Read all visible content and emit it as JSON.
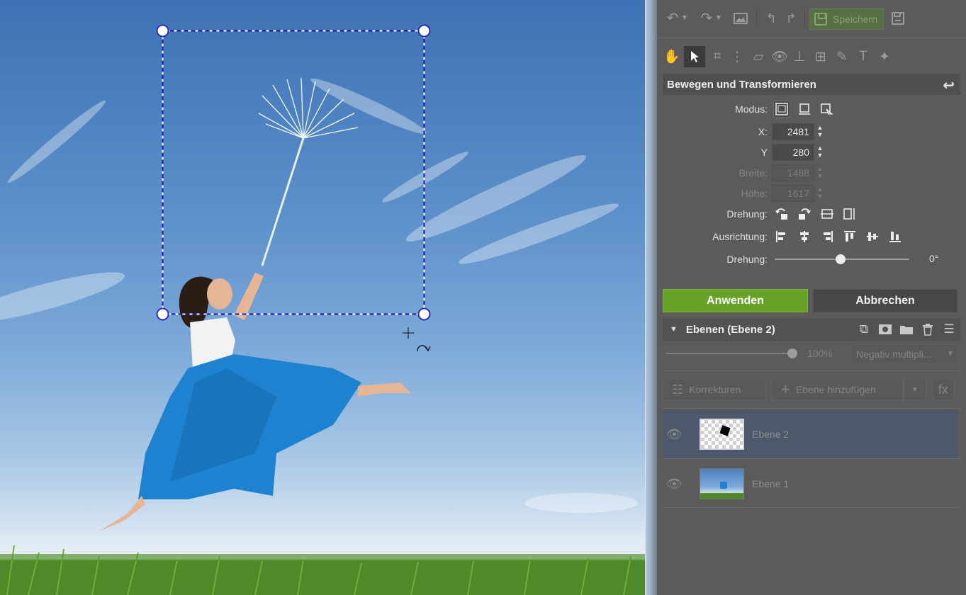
{
  "toolbar": {
    "save_label": "Speichern",
    "icons": [
      "undo-icon",
      "redo-icon",
      "image-icon",
      "rotate-left-icon",
      "rotate-right-icon",
      "save-icon",
      "save-as-icon"
    ]
  },
  "tools": [
    "hand-icon",
    "move-tool-icon",
    "crop-icon",
    "straighten-icon",
    "perspective-icon",
    "redeye-icon",
    "stamp-icon",
    "grid-icon",
    "brush-icon",
    "text-icon",
    "effects-icon"
  ],
  "transform": {
    "title": "Bewegen und Transformieren",
    "mode_label": "Modus:",
    "x_label": "X:",
    "x_value": "2481",
    "y_label": "Y",
    "y_value": "280",
    "width_label": "Breite:",
    "width_value": "1488",
    "height_label": "Höhe:",
    "height_value": "1617",
    "rotation_label": "Drehung:",
    "alignment_label": "Ausrichtung:",
    "rotation_slider_label": "Drehung:",
    "rotation_degrees": "0°"
  },
  "actions": {
    "apply": "Anwenden",
    "cancel": "Abbrechen"
  },
  "layers": {
    "title": "Ebenen (Ebene 2)",
    "opacity": "100%",
    "blend_mode": "Negativ multipli...",
    "corrections": "Korrekturen",
    "add_layer": "Ebene hinzufügen",
    "fx": "fx",
    "items": [
      {
        "name": "Ebene 2",
        "selected": true
      },
      {
        "name": "Ebene 1",
        "selected": false
      }
    ]
  },
  "colors": {
    "apply": "#67a228",
    "selection_handle": "#2b2bb5",
    "panel": "#5b5b5b"
  }
}
